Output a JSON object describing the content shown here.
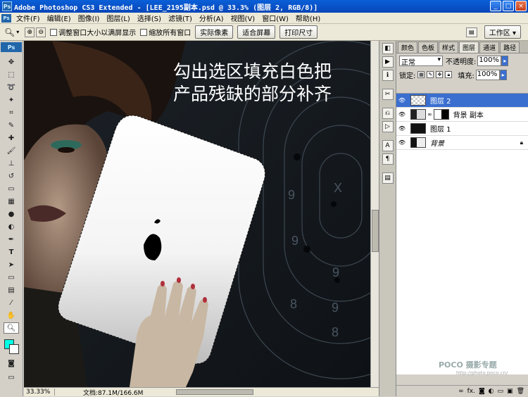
{
  "titlebar": {
    "title": "Adobe Photoshop CS3 Extended - [LEE_2195副本.psd @ 33.3% (图层 2, RGB/8)]",
    "app_icon": "Ps",
    "minimize": "_",
    "maximize": "□",
    "close": "×"
  },
  "menu": {
    "logo": "Ps",
    "items": [
      "文件(F)",
      "编辑(E)",
      "图像(I)",
      "图层(L)",
      "选择(S)",
      "滤镜(T)",
      "分析(A)",
      "视图(V)",
      "窗口(W)",
      "帮助(H)"
    ]
  },
  "options": {
    "resize_windows": "调整窗口大小以满屏显示",
    "zoom_all": "缩放所有窗口",
    "actual_pixels": "实际像素",
    "fit_screen": "适合屏幕",
    "print_size": "打印尺寸",
    "workspace": "工作区 ▾"
  },
  "toolbox": {
    "header": "Ps"
  },
  "colors": {
    "foreground": "#00ffe4",
    "background": "#ffffff",
    "selection_blue": "#3a6fd0"
  },
  "canvas": {
    "caption_line1": "勾出选区填充白色把",
    "caption_line2": "产品残缺的部分补齐",
    "watermark": "POCO 摄影专题",
    "watermark_url": "http://photo.poco.cn/",
    "target_digits": [
      "9",
      "9",
      "X",
      "9",
      "8",
      "9",
      "8"
    ]
  },
  "status": {
    "zoom": "33.33%",
    "doc": "文档:87.1M/166.6M"
  },
  "panel": {
    "tabs": [
      "颜色",
      "色板",
      "样式",
      "图层",
      "通道",
      "路径"
    ],
    "active_tab": "图层",
    "blend_mode": "正常",
    "opacity_label": "不透明度:",
    "opacity": "100%",
    "lock_label": "锁定:",
    "fill_label": "填充:",
    "fill": "100%",
    "layers": [
      {
        "name": "图层 2",
        "active": true
      },
      {
        "name": "背景 副本",
        "active": false
      },
      {
        "name": "图层 1",
        "active": false
      },
      {
        "name": "背景",
        "active": false,
        "locked": true
      }
    ]
  }
}
